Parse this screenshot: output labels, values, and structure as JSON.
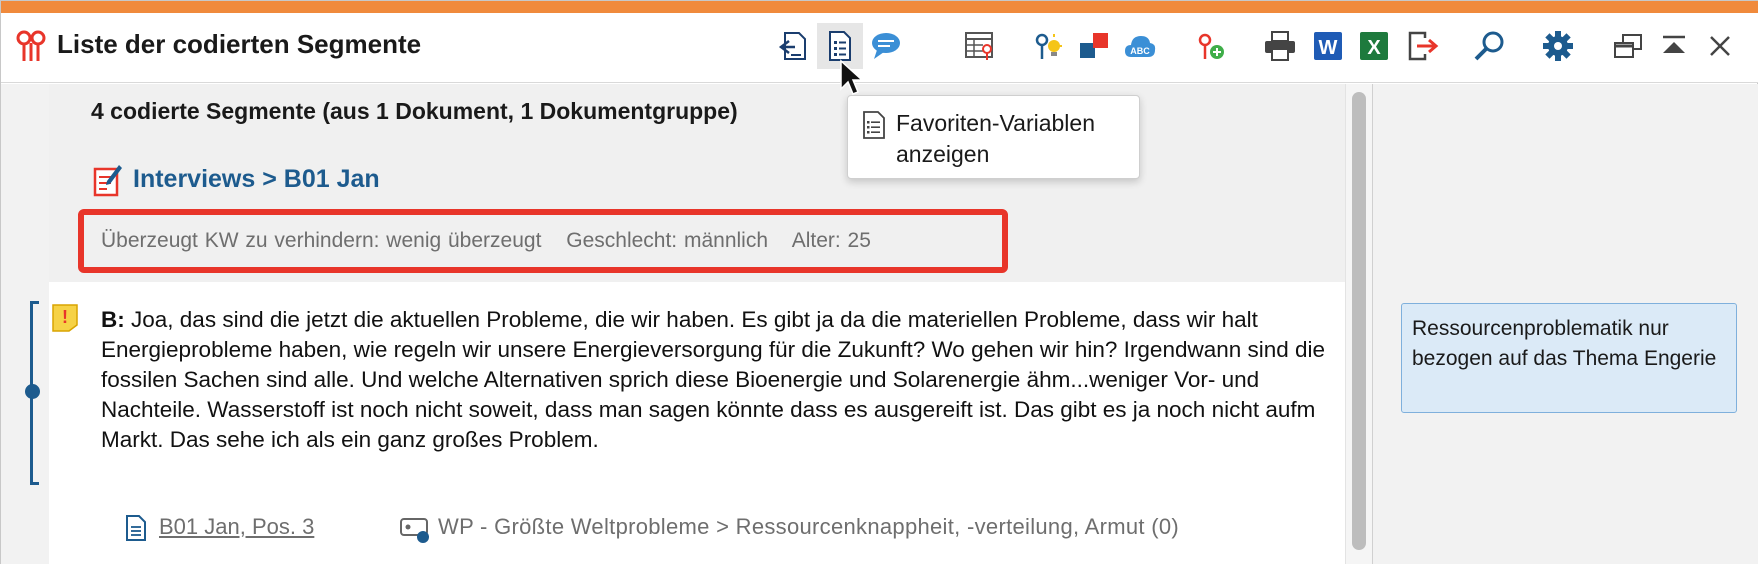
{
  "window": {
    "title": "Liste der codierten Segmente",
    "accent_color": "#f08a3c"
  },
  "toolbar": {
    "buttons": [
      {
        "name": "export-to-document-icon"
      },
      {
        "name": "favorite-variables-icon"
      },
      {
        "name": "comment-icon"
      },
      {
        "name": "table-codes-icon"
      },
      {
        "name": "code-lightbulb-icon"
      },
      {
        "name": "color-codes-icon"
      },
      {
        "name": "word-cloud-icon"
      },
      {
        "name": "add-code-icon"
      },
      {
        "name": "print-icon"
      },
      {
        "name": "word-export-icon"
      },
      {
        "name": "excel-export-icon"
      },
      {
        "name": "export-icon"
      },
      {
        "name": "search-icon"
      },
      {
        "name": "settings-icon"
      },
      {
        "name": "undock-window-icon"
      },
      {
        "name": "minimize-window-icon"
      },
      {
        "name": "close-icon"
      }
    ],
    "word_label": "W",
    "excel_label": "X",
    "cloud_label": "ABC"
  },
  "tooltip": {
    "line1": "Favoriten-Variablen",
    "line2": "anzeigen"
  },
  "summary": "4 codierte Segmente (aus 1 Dokument, 1 Dokumentgruppe)",
  "document": {
    "link": "Interviews > B01 Jan"
  },
  "variables": [
    "Überzeugt KW zu verhindern: wenig überzeugt",
    "Geschlecht: männlich",
    "Alter: 25"
  ],
  "highlight_color": "#e8352a",
  "segment": {
    "speaker": "B:",
    "text": "Joa, das sind die jetzt die aktuellen Probleme, die wir haben. Es gibt ja da die materiellen Probleme, dass wir halt Energieprobleme haben, wie regeln wir unsere Energieversorgung für die Zukunft? Wo gehen wir hin? Irgendwann sind die fossilen Sachen sind alle. Und welche Alternativen sprich diese Bioenergie und Solarenergie ähm...weniger Vor- und Nachteile. Wasserstoff ist noch nicht soweit, dass man sagen könnte dass es ausgereift ist. Das gibt es ja noch nicht aufm Markt. Das sehe ich als ein ganz großes Problem.",
    "source": "B01 Jan, Pos. 3",
    "code": "WP - Größte Weltprobleme > Ressourcenknappheit, -verteilung, Armut (0)",
    "memo_badge": "!"
  },
  "memo": {
    "text": "Ressourcenproblematik nur bezogen auf das Thema Engerie"
  }
}
